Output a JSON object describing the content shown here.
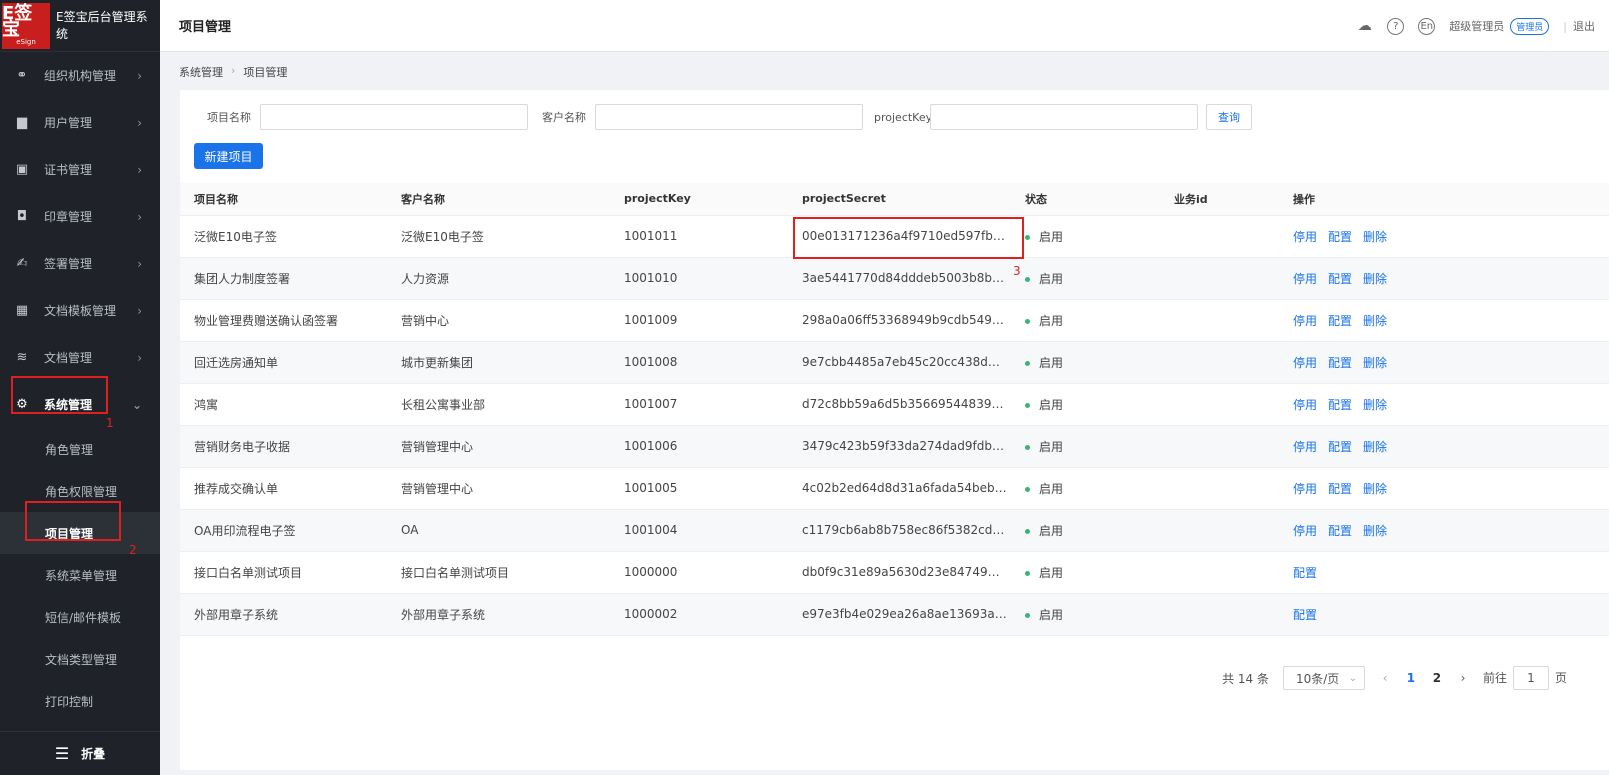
{
  "brand": {
    "logo_text": "E签宝",
    "logo_sub": "eSign",
    "title": "E签宝后台管理系统"
  },
  "sidebar": {
    "items": [
      {
        "label": "组织机构管理",
        "icon": "org-icon"
      },
      {
        "label": "用户管理",
        "icon": "user-icon"
      },
      {
        "label": "证书管理",
        "icon": "certificate-icon"
      },
      {
        "label": "印章管理",
        "icon": "seal-icon"
      },
      {
        "label": "签署管理",
        "icon": "sign-icon"
      },
      {
        "label": "文档模板管理",
        "icon": "template-icon"
      },
      {
        "label": "文档管理",
        "icon": "document-icon"
      },
      {
        "label": "系统管理",
        "icon": "gear-icon"
      }
    ],
    "subitems": [
      "角色管理",
      "角色权限管理",
      "项目管理",
      "系统菜单管理",
      "短信/邮件模板",
      "文档类型管理",
      "打印控制"
    ],
    "collapse_label": "折叠"
  },
  "header": {
    "title": "项目管理",
    "lang": "En",
    "user": "超级管理员",
    "role": "管理员",
    "logout": "退出"
  },
  "breadcrumb": [
    "系统管理",
    "项目管理"
  ],
  "filters": {
    "project_name_label": "项目名称",
    "customer_name_label": "客户名称",
    "project_key_label": "projectKey",
    "query_label": "查询",
    "new_label": "新建项目"
  },
  "table": {
    "columns": [
      "项目名称",
      "客户名称",
      "projectKey",
      "projectSecret",
      "状态",
      "业务id",
      "操作"
    ],
    "rows": [
      {
        "name": "泛微E10电子签",
        "customer": "泛微E10电子签",
        "key": "1001011",
        "secret": "00e013171236a4f9710ed597fbb8fb66",
        "status": "启用",
        "biz": "",
        "ops": [
          "停用",
          "配置",
          "删除"
        ]
      },
      {
        "name": "集团人力制度签署",
        "customer": "人力资源",
        "key": "1001010",
        "secret": "3ae5441770d84dddeb5003b8bb51b...",
        "status": "启用",
        "biz": "",
        "ops": [
          "停用",
          "配置",
          "删除"
        ]
      },
      {
        "name": "物业管理费赠送确认函签署",
        "customer": "营销中心",
        "key": "1001009",
        "secret": "298a0a06ff53368949b9cdb54981eaf",
        "status": "启用",
        "biz": "",
        "ops": [
          "停用",
          "配置",
          "删除"
        ]
      },
      {
        "name": "回迁选房通知单",
        "customer": "城市更新集团",
        "key": "1001008",
        "secret": "9e7cbb4485a7eb45c20cc438d2e08...",
        "status": "启用",
        "biz": "",
        "ops": [
          "停用",
          "配置",
          "删除"
        ]
      },
      {
        "name": "鸿寓",
        "customer": "长租公寓事业部",
        "key": "1001007",
        "secret": "d72c8bb59a6d5b356695448390a24...",
        "status": "启用",
        "biz": "",
        "ops": [
          "停用",
          "配置",
          "删除"
        ]
      },
      {
        "name": "营销财务电子收据",
        "customer": "营销管理中心",
        "key": "1001006",
        "secret": "3479c423b59f33da274dad9fdb56749c",
        "status": "启用",
        "biz": "",
        "ops": [
          "停用",
          "配置",
          "删除"
        ]
      },
      {
        "name": "推荐成交确认单",
        "customer": "营销管理中心",
        "key": "1001005",
        "secret": "4c02b2ed64d8d31a6fada54bebc8bd...",
        "status": "启用",
        "biz": "",
        "ops": [
          "停用",
          "配置",
          "删除"
        ]
      },
      {
        "name": "OA用印流程电子签",
        "customer": "OA",
        "key": "1001004",
        "secret": "c1179cb6ab8b758ec86f5382cd473523",
        "status": "启用",
        "biz": "",
        "ops": [
          "停用",
          "配置",
          "删除"
        ]
      },
      {
        "name": "接口白名单测试项目",
        "customer": "接口白名单测试项目",
        "key": "1000000",
        "secret": "db0f9c31e89a5630d23e847495eba1...",
        "status": "启用",
        "biz": "",
        "ops": [
          "配置"
        ]
      },
      {
        "name": "外部用章子系统",
        "customer": "外部用章子系统",
        "key": "1000002",
        "secret": "e97e3fb4e029ea26a8ae13693a7a4...",
        "status": "启用",
        "biz": "",
        "ops": [
          "配置"
        ]
      }
    ]
  },
  "pagination": {
    "total": "共 14 条",
    "page_size": "10条/页",
    "pages": [
      "1",
      "2"
    ],
    "goto_prefix": "前往",
    "goto_value": "1",
    "goto_suffix": "页"
  },
  "annotations": [
    "1",
    "2",
    "3"
  ],
  "colors": {
    "accent": "#1a73e8",
    "sidebar_bg": "#1f2329",
    "annotation": "#e02020",
    "status_dot": "#3cb371"
  }
}
